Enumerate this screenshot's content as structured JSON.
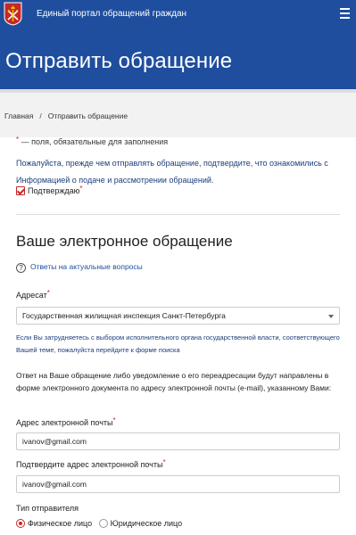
{
  "header": {
    "portal_title": "Единый портал обращений граждан",
    "logo_icon": "spb-coat-of-arms-icon",
    "menu_icon": "hamburger-menu-icon",
    "bg_color": "#1f4e9e"
  },
  "hero": {
    "title": "Отправить обращение"
  },
  "breadcrumb": {
    "home": "Главная",
    "separator": "/",
    "current": "Отправить обращение"
  },
  "form": {
    "required_mark": "*",
    "required_note": "— поля, обязательные для заполнения",
    "intro_text": "Пожалуйста, прежде чем отправлять обращение, подтвердите, что ознакомились с Информацией о подаче и рассмотрении обращений.",
    "confirm_label": "Подтверждаю",
    "confirm_checked": true,
    "section_title": "Ваше электронное обращение",
    "faq_link": "Ответы на актуальные вопросы",
    "faq_icon_glyph": "?",
    "addressee_label": "Адресат",
    "addressee_value": "Государственная жилищная инспекция Санкт-Петербурга",
    "addressee_help": "Если Вы затрудняетесь с выбором исполнительного органа государственной власти, соответствующего Вашей теме, пожалуйста перейдите к форме поиска",
    "response_note": "Ответ на Ваше обращение либо уведомление о его переадресации будут направлены в форме электронного документа по адресу электронной почты (e-mail), указанному Вами:",
    "email_label": "Адрес электронной почты",
    "email_value": "ivanov@gmail.com",
    "email_confirm_label": "Подтвердите адрес электронной почты",
    "email_confirm_value": "ivanov@gmail.com",
    "sender_type_label": "Тип отправителя",
    "sender_types": [
      "Физическое лицо",
      "Юридическое лицо"
    ],
    "sender_selected": "Физическое лицо",
    "accent_color": "#c62828"
  }
}
